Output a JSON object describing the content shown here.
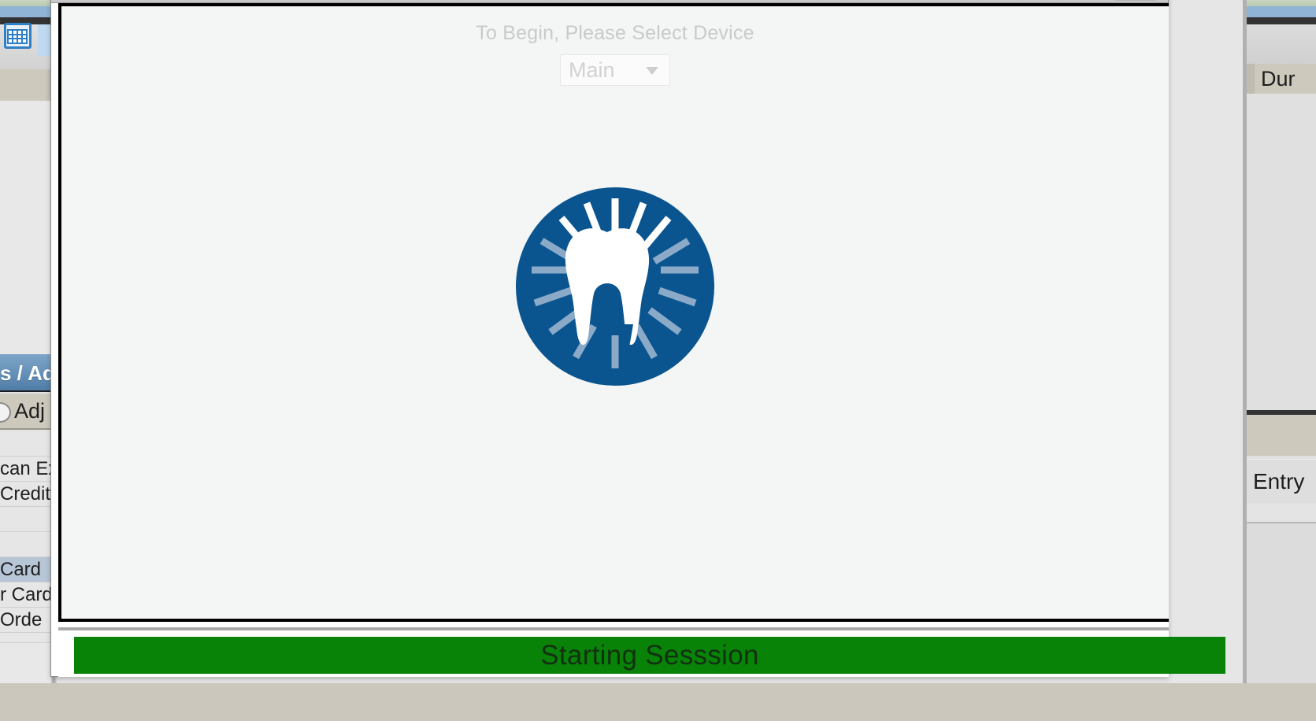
{
  "background_app": {
    "left_panel": {
      "grid_icon": "grid-icon",
      "section_header": "s / Ad",
      "adjust_radio_label": "Adj",
      "payment_rows": [
        {
          "label": "",
          "selected": false
        },
        {
          "label": "can Ex",
          "selected": false
        },
        {
          "label": "Credit",
          "selected": false
        },
        {
          "label": "",
          "selected": false
        },
        {
          "label": "",
          "selected": false
        },
        {
          "label": "Card",
          "selected": true
        },
        {
          "label": "r Card",
          "selected": false
        },
        {
          "label": "Orde",
          "selected": false
        }
      ]
    },
    "right_panel": {
      "column_header_duration": "Dur",
      "column_header_entry": "Entry"
    }
  },
  "dialog": {
    "title": "",
    "close_button_label": "",
    "prompt": "To Begin, Please Select Device",
    "device_select": {
      "value": "Main",
      "placeholder": "Main",
      "options": [
        "Main"
      ],
      "caret_icon": "chevron-down-icon"
    },
    "logo": {
      "name": "tooth-logo",
      "circle_color": "#0a548f",
      "tooth_color": "#ffffff",
      "ray_color_light": "#ffffff",
      "ray_color_muted": "#8aaac8"
    },
    "progress": {
      "status_text": "Starting Sesssion",
      "bar_color": "#088308",
      "text_color": "#123012",
      "percent": 100
    }
  }
}
